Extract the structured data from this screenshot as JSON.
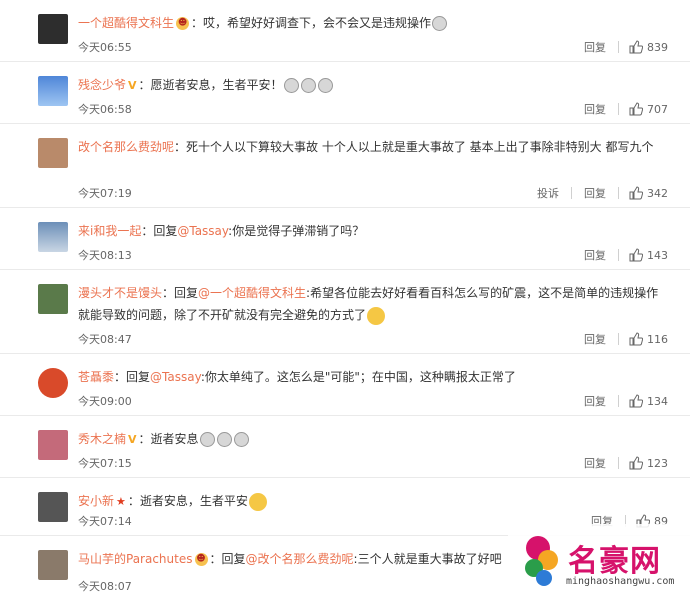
{
  "comments": [
    {
      "user": "一个超酷得文科生",
      "badge": "face",
      "prefix": "：",
      "reply_to": "",
      "text": "哎，希望好好调查下，会不会又是违规操作",
      "time": "今天06:55",
      "report": "",
      "reply": "回复",
      "likes": "839",
      "avatar": "#2d2d2d"
    },
    {
      "user": "残念少爷",
      "badge": "vip",
      "prefix": "：",
      "reply_to": "",
      "text": "愿逝者安息，生者平安！",
      "time": "今天06:58",
      "report": "",
      "reply": "回复",
      "likes": "707",
      "avatar": "#4f86d8"
    },
    {
      "user": "改个名那么费劲呢",
      "badge": "",
      "prefix": "：",
      "reply_to": "",
      "text": "死十个人以下算较大事故 十个人以上就是重大事故了 基本上出了事除非特别大 都写九个",
      "time": "今天07:19",
      "report": "投诉",
      "reply": "回复",
      "likes": "342",
      "avatar": "#b98a6a"
    },
    {
      "user": "来i和我一起",
      "badge": "",
      "prefix": "：回复",
      "reply_to": "@Tassay",
      "text": ":你是觉得子弹滞销了吗？",
      "time": "今天08:13",
      "report": "",
      "reply": "回复",
      "likes": "143",
      "avatar": "#6c8fb8"
    },
    {
      "user": "漫头才不是馒头",
      "badge": "",
      "prefix": "：回复",
      "reply_to": "@一个超酷得文科生",
      "text": ":希望各位能去好好看看百科怎么写的矿震，这不是简单的违规操作就能导致的问题，除了不开矿就没有完全避免的方式了",
      "time": "今天08:47",
      "report": "",
      "reply": "回复",
      "likes": "116",
      "avatar": "#5a7a4a"
    },
    {
      "user": "苍聶黍",
      "badge": "",
      "prefix": "：回复",
      "reply_to": "@Tassay",
      "text": ":你太单纯了。这怎么是\"可能\"；在中国，这种瞒报太正常了",
      "time": "今天09:00",
      "report": "",
      "reply": "回复",
      "likes": "134",
      "avatar": "#d94a2a"
    },
    {
      "user": "秀木之楠",
      "badge": "vip",
      "prefix": "：",
      "reply_to": "",
      "text": "逝者安息",
      "time": "今天07:15",
      "report": "",
      "reply": "回复",
      "likes": "123",
      "avatar": "#c46a7a"
    },
    {
      "user": "安小新",
      "badge": "star",
      "prefix": "：",
      "reply_to": "",
      "text": "逝者安息，生者平安",
      "time": "今天07:14",
      "report": "",
      "reply": "回复",
      "likes": "89",
      "avatar": "#555555"
    },
    {
      "user": "马山芋的Parachutes",
      "badge": "face",
      "prefix": "：回复",
      "reply_to": "@改个名那么费劲呢",
      "text": ":三个人就是重大事故了好吧",
      "time": "今天08:07",
      "report": "",
      "reply": "回复",
      "likes": "",
      "avatar": "#8a7a6a"
    }
  ],
  "watermark": {
    "title": "名豪网",
    "url": "minghaoshangwu.com"
  }
}
